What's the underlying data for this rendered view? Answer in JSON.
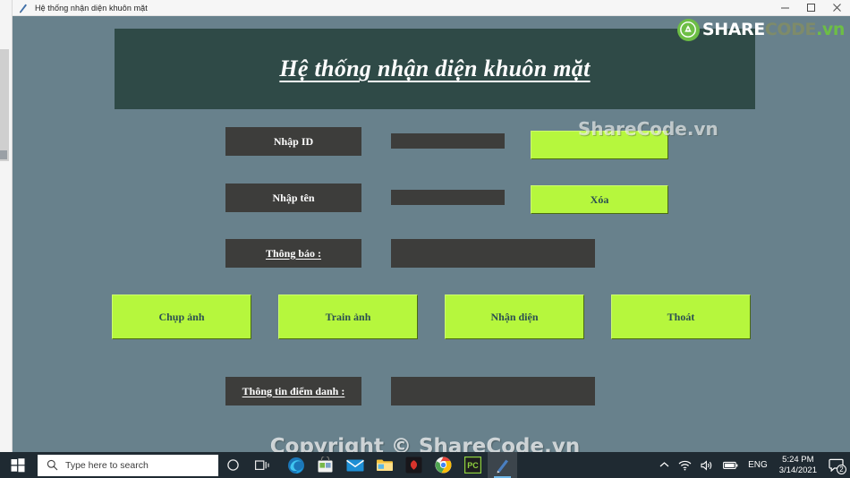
{
  "window": {
    "title": "Hệ thống nhận diện khuôn mặt",
    "icon": "python-editor-icon",
    "minimize_label": "Minimize",
    "maximize_label": "Maximize",
    "close_label": "Close"
  },
  "logo": {
    "share": "SHARE",
    "code": "CODE",
    "vn": ".vn"
  },
  "app": {
    "banner_title": "Hệ thống nhận diện khuôn mặt",
    "background_color": "#68818c",
    "banner_color": "#2f4a47",
    "plate_color": "#3d3d3b",
    "button_color": "#b6f73d",
    "button_text_color": "#2c4f52"
  },
  "form": {
    "rows": [
      {
        "label": "Nhập ID",
        "value": ""
      },
      {
        "label": "Nhập tên",
        "value": ""
      },
      {
        "label": "Thông báo :",
        "value": ""
      },
      {
        "label": "Thông tin điểm danh :",
        "value": ""
      }
    ],
    "side_buttons": [
      {
        "label": "",
        "name": "add-button"
      },
      {
        "label": "Xóa",
        "name": "delete-button"
      }
    ],
    "action_buttons": [
      {
        "label": "Chụp ảnh"
      },
      {
        "label": "Train ảnh"
      },
      {
        "label": "Nhận diện"
      },
      {
        "label": "Thoát"
      }
    ]
  },
  "watermarks": {
    "sharecode": "ShareCode.vn",
    "copyright": "Copyright © ShareCode.vn"
  },
  "taskbar": {
    "start_label": "Start",
    "search_placeholder": "Type here to search",
    "cortana_label": "Cortana",
    "taskview_label": "Task View",
    "apps": [
      {
        "name": "edge-icon",
        "label": "Microsoft Edge"
      },
      {
        "name": "microsoft-store-icon",
        "label": "Microsoft Store"
      },
      {
        "name": "mail-icon",
        "label": "Mail"
      },
      {
        "name": "file-explorer-icon",
        "label": "File Explorer"
      },
      {
        "name": "red-app-icon",
        "label": "App"
      },
      {
        "name": "chrome-icon",
        "label": "Google Chrome"
      },
      {
        "name": "pycharm-icon",
        "label": "PyCharm"
      },
      {
        "name": "python-editor-icon",
        "label": "Hệ thống nhận diện khuôn mặt"
      }
    ],
    "tray": {
      "show_hidden_label": "Show hidden icons",
      "network_label": "Network",
      "volume_label": "Volume",
      "battery_label": "Battery",
      "language": "ENG",
      "time": "5:24 PM",
      "date": "3/14/2021",
      "notification_count": "2"
    }
  }
}
